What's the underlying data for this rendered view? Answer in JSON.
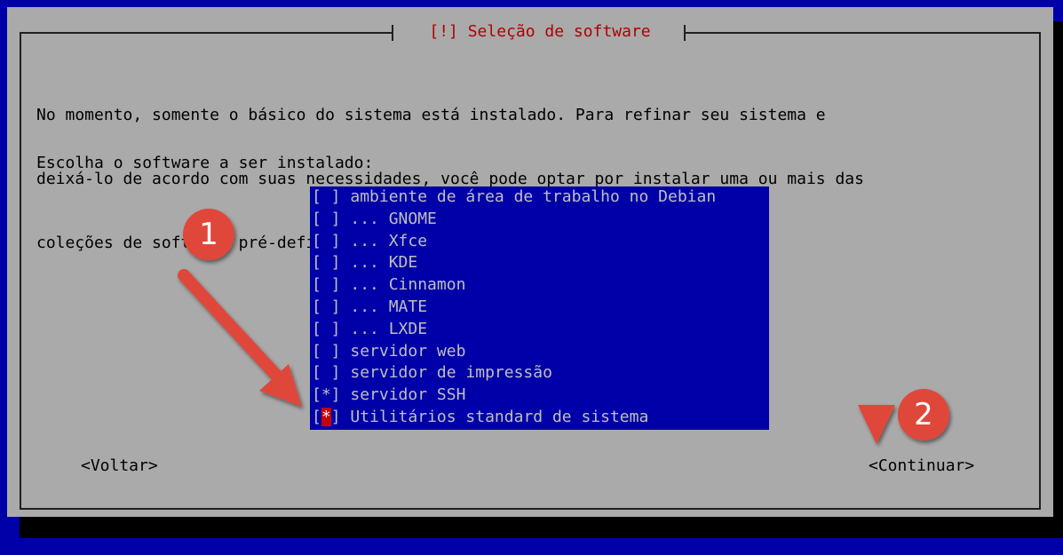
{
  "dialog": {
    "title": "[!] Seleção de software",
    "description": [
      "No momento, somente o básico do sistema está instalado. Para refinar seu sistema e",
      "deixá-lo de acordo com suas necessidades, você pode optar por instalar uma ou mais das",
      "coleções de software pré-definidas a seguir."
    ],
    "prompt": "Escolha o software a ser instalado:"
  },
  "software_list": [
    {
      "mark": "[ ]",
      "label": "ambiente de área de trabalho no Debian",
      "checked": false
    },
    {
      "mark": "[ ]",
      "label": "... GNOME",
      "checked": false
    },
    {
      "mark": "[ ]",
      "label": "... Xfce",
      "checked": false
    },
    {
      "mark": "[ ]",
      "label": "... KDE",
      "checked": false
    },
    {
      "mark": "[ ]",
      "label": "... Cinnamon",
      "checked": false
    },
    {
      "mark": "[ ]",
      "label": "... MATE",
      "checked": false
    },
    {
      "mark": "[ ]",
      "label": "... LXDE",
      "checked": false
    },
    {
      "mark": "[ ]",
      "label": "servidor web",
      "checked": false
    },
    {
      "mark": "[ ]",
      "label": "servidor de impressão",
      "checked": false
    },
    {
      "mark": "[*]",
      "label": "servidor SSH",
      "checked": true
    },
    {
      "mark": "[*]",
      "label": "Utilitários standard de sistema",
      "checked": true,
      "cursor": true
    }
  ],
  "buttons": {
    "back": "<Voltar>",
    "continue": "<Continuar>"
  },
  "annotations": {
    "badge1": "1",
    "badge2": "2",
    "color": "#e0473a"
  }
}
